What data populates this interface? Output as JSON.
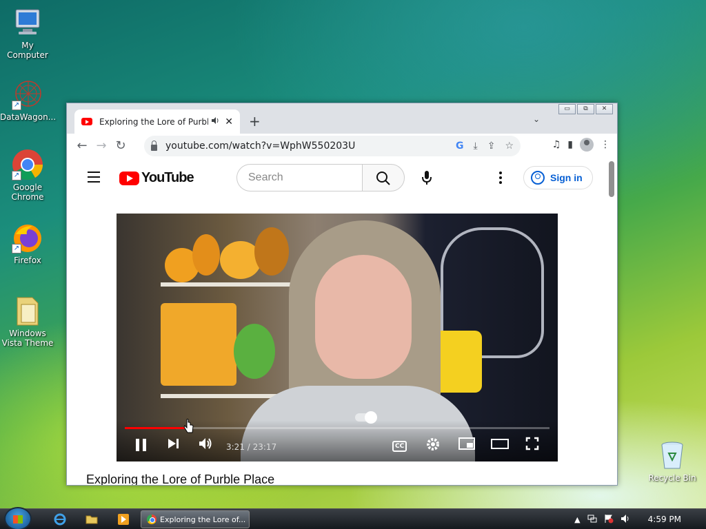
{
  "desktop": {
    "icons": [
      {
        "label": "My Computer"
      },
      {
        "label": "DataWagon..."
      },
      {
        "label": "Google Chrome"
      },
      {
        "label": "Firefox"
      },
      {
        "label": "Windows Vista Theme"
      },
      {
        "label": "Recycle Bin"
      }
    ]
  },
  "browser": {
    "tab": {
      "title": "Exploring the Lore of Purble",
      "sound_icon": "speaker-icon",
      "close": "✕"
    },
    "new_tab": "+",
    "tab_list": "⌄",
    "window_controls": {
      "minimize": "▭",
      "restore": "⧉",
      "close": "✕"
    },
    "nav": {
      "back": "←",
      "forward": "→",
      "reload": "↻"
    },
    "address": {
      "url": "youtube.com/watch?v=WphW550203U"
    },
    "omni_icons": {
      "google": "G",
      "install": "⤓",
      "share": "⇪",
      "bookmark": "☆"
    },
    "right_tools": {
      "media": "♫",
      "sidepanel": "▮",
      "menu": "⋮"
    }
  },
  "youtube": {
    "logo_text": "YouTube",
    "search_placeholder": "Search",
    "more": "⋮",
    "signin": "Sign in",
    "player": {
      "progress_percent": 14.5,
      "time": "3:21 / 23:17"
    },
    "video_title": "Exploring the Lore of Purble Place"
  },
  "taskbar": {
    "task": "Exploring the Lore of...",
    "tray_arrow": "▲",
    "clock": "4:59 PM"
  }
}
